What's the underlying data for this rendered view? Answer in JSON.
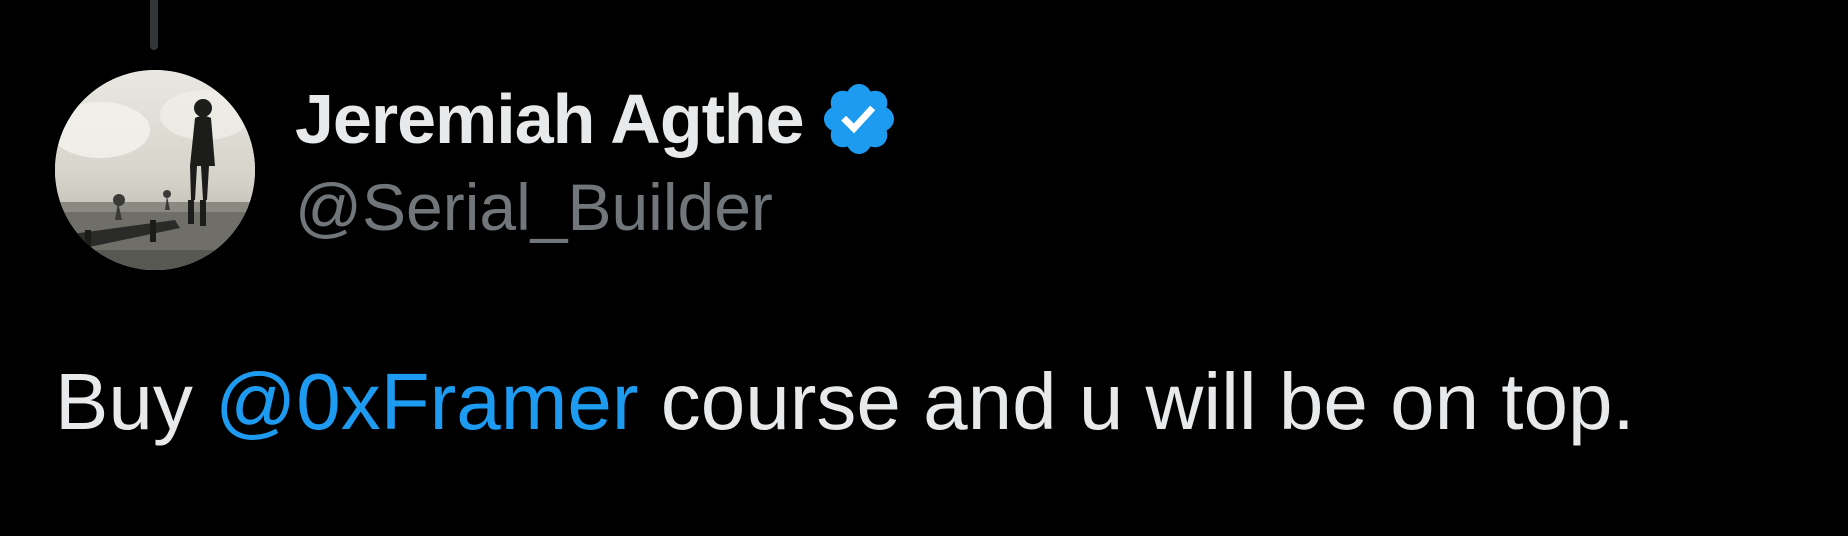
{
  "tweet": {
    "author": {
      "display_name": "Jeremiah Agthe",
      "handle": "@Serial_Builder",
      "verified": true,
      "verified_color": "#1d9bf0",
      "avatar_icon": "avatar-photo"
    },
    "text": {
      "before_mention": "Buy ",
      "mention": "@0xFramer",
      "after_mention": " course and u will be on top."
    },
    "colors": {
      "background": "#000000",
      "text": "#e7e9ea",
      "secondary_text": "#71767b",
      "link": "#1d9bf0",
      "thread_line": "#333639"
    }
  }
}
